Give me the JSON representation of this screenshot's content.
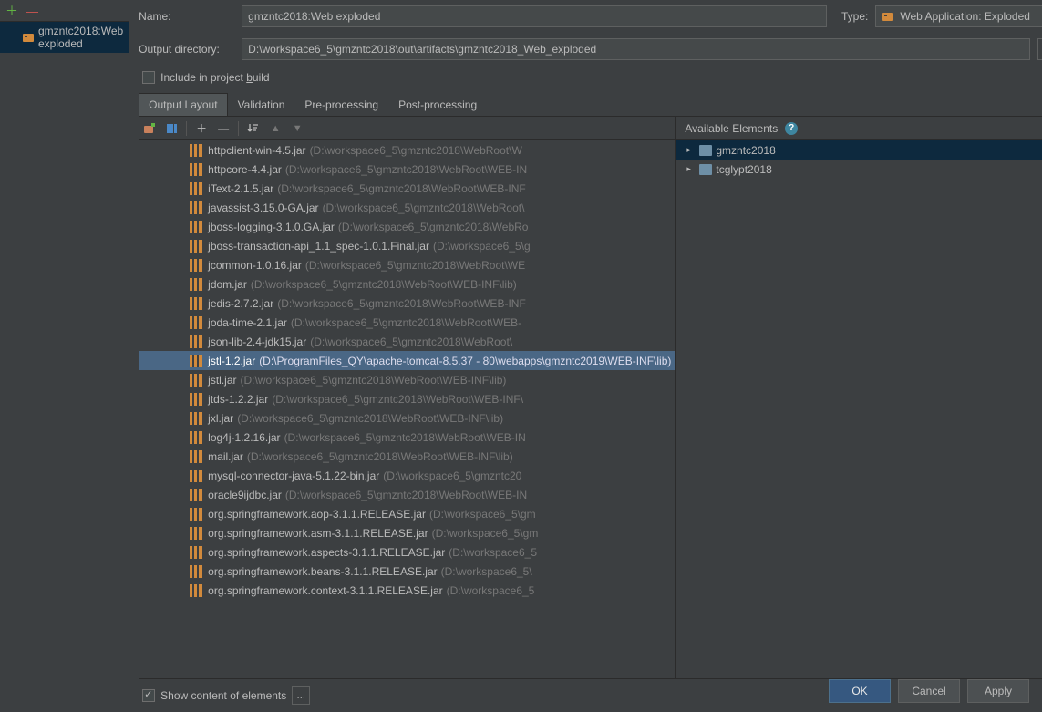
{
  "artifact_list": {
    "selected": "gmzntc2018:Web exploded"
  },
  "form": {
    "name_label": "Name:",
    "name_value": "gmzntc2018:Web exploded",
    "type_label": "Type:",
    "type_value": "Web Application: Exploded",
    "output_label": "Output directory:",
    "output_value": "D:\\workspace6_5\\gmzntc2018\\out\\artifacts\\gmzntc2018_Web_exploded",
    "include_label_pre": "Include in project ",
    "include_label_u": "b",
    "include_label_post": "uild"
  },
  "tabs": {
    "t0": "Output Layout",
    "t1": "Validation",
    "t2": "Pre-processing",
    "t3": "Post-processing"
  },
  "available": {
    "header": "Available Elements",
    "item0": "gmzntc2018",
    "item1": "tcglypt2018"
  },
  "show_content": {
    "label": "Show content of elements",
    "ellipsis": "…"
  },
  "buttons": {
    "ok": "OK",
    "cancel": "Cancel",
    "apply": "Apply"
  },
  "jars": [
    {
      "n": "httpclient-win-4.5.jar",
      "p": "(D:\\workspace6_5\\gmzntc2018\\WebRoot\\W"
    },
    {
      "n": "httpcore-4.4.jar",
      "p": "(D:\\workspace6_5\\gmzntc2018\\WebRoot\\WEB-IN"
    },
    {
      "n": "iText-2.1.5.jar",
      "p": "(D:\\workspace6_5\\gmzntc2018\\WebRoot\\WEB-INF"
    },
    {
      "n": "javassist-3.15.0-GA.jar",
      "p": "(D:\\workspace6_5\\gmzntc2018\\WebRoot\\"
    },
    {
      "n": "jboss-logging-3.1.0.GA.jar",
      "p": "(D:\\workspace6_5\\gmzntc2018\\WebRo"
    },
    {
      "n": "jboss-transaction-api_1.1_spec-1.0.1.Final.jar",
      "p": "(D:\\workspace6_5\\g"
    },
    {
      "n": "jcommon-1.0.16.jar",
      "p": "(D:\\workspace6_5\\gmzntc2018\\WebRoot\\WE"
    },
    {
      "n": "jdom.jar",
      "p": "(D:\\workspace6_5\\gmzntc2018\\WebRoot\\WEB-INF\\lib)"
    },
    {
      "n": "jedis-2.7.2.jar",
      "p": "(D:\\workspace6_5\\gmzntc2018\\WebRoot\\WEB-INF"
    },
    {
      "n": "joda-time-2.1.jar",
      "p": "(D:\\workspace6_5\\gmzntc2018\\WebRoot\\WEB-"
    },
    {
      "n": "json-lib-2.4-jdk15.jar",
      "p": "(D:\\workspace6_5\\gmzntc2018\\WebRoot\\"
    },
    {
      "n": "jstl-1.2.jar",
      "p": "(D:\\ProgramFiles_QY\\apache-tomcat-8.5.37 - 80\\webapps\\gmzntc2019\\WEB-INF\\lib)",
      "sel": true
    },
    {
      "n": "jstl.jar",
      "p": "(D:\\workspace6_5\\gmzntc2018\\WebRoot\\WEB-INF\\lib)"
    },
    {
      "n": "jtds-1.2.2.jar",
      "p": "(D:\\workspace6_5\\gmzntc2018\\WebRoot\\WEB-INF\\"
    },
    {
      "n": "jxl.jar",
      "p": "(D:\\workspace6_5\\gmzntc2018\\WebRoot\\WEB-INF\\lib)"
    },
    {
      "n": "log4j-1.2.16.jar",
      "p": "(D:\\workspace6_5\\gmzntc2018\\WebRoot\\WEB-IN"
    },
    {
      "n": "mail.jar",
      "p": "(D:\\workspace6_5\\gmzntc2018\\WebRoot\\WEB-INF\\lib)"
    },
    {
      "n": "mysql-connector-java-5.1.22-bin.jar",
      "p": "(D:\\workspace6_5\\gmzntc20"
    },
    {
      "n": "oracle9ijdbc.jar",
      "p": "(D:\\workspace6_5\\gmzntc2018\\WebRoot\\WEB-IN"
    },
    {
      "n": "org.springframework.aop-3.1.1.RELEASE.jar",
      "p": "(D:\\workspace6_5\\gm"
    },
    {
      "n": "org.springframework.asm-3.1.1.RELEASE.jar",
      "p": "(D:\\workspace6_5\\gm"
    },
    {
      "n": "org.springframework.aspects-3.1.1.RELEASE.jar",
      "p": "(D:\\workspace6_5"
    },
    {
      "n": "org.springframework.beans-3.1.1.RELEASE.jar",
      "p": "(D:\\workspace6_5\\"
    },
    {
      "n": "org.springframework.context-3.1.1.RELEASE.jar",
      "p": "(D:\\workspace6_5"
    }
  ]
}
